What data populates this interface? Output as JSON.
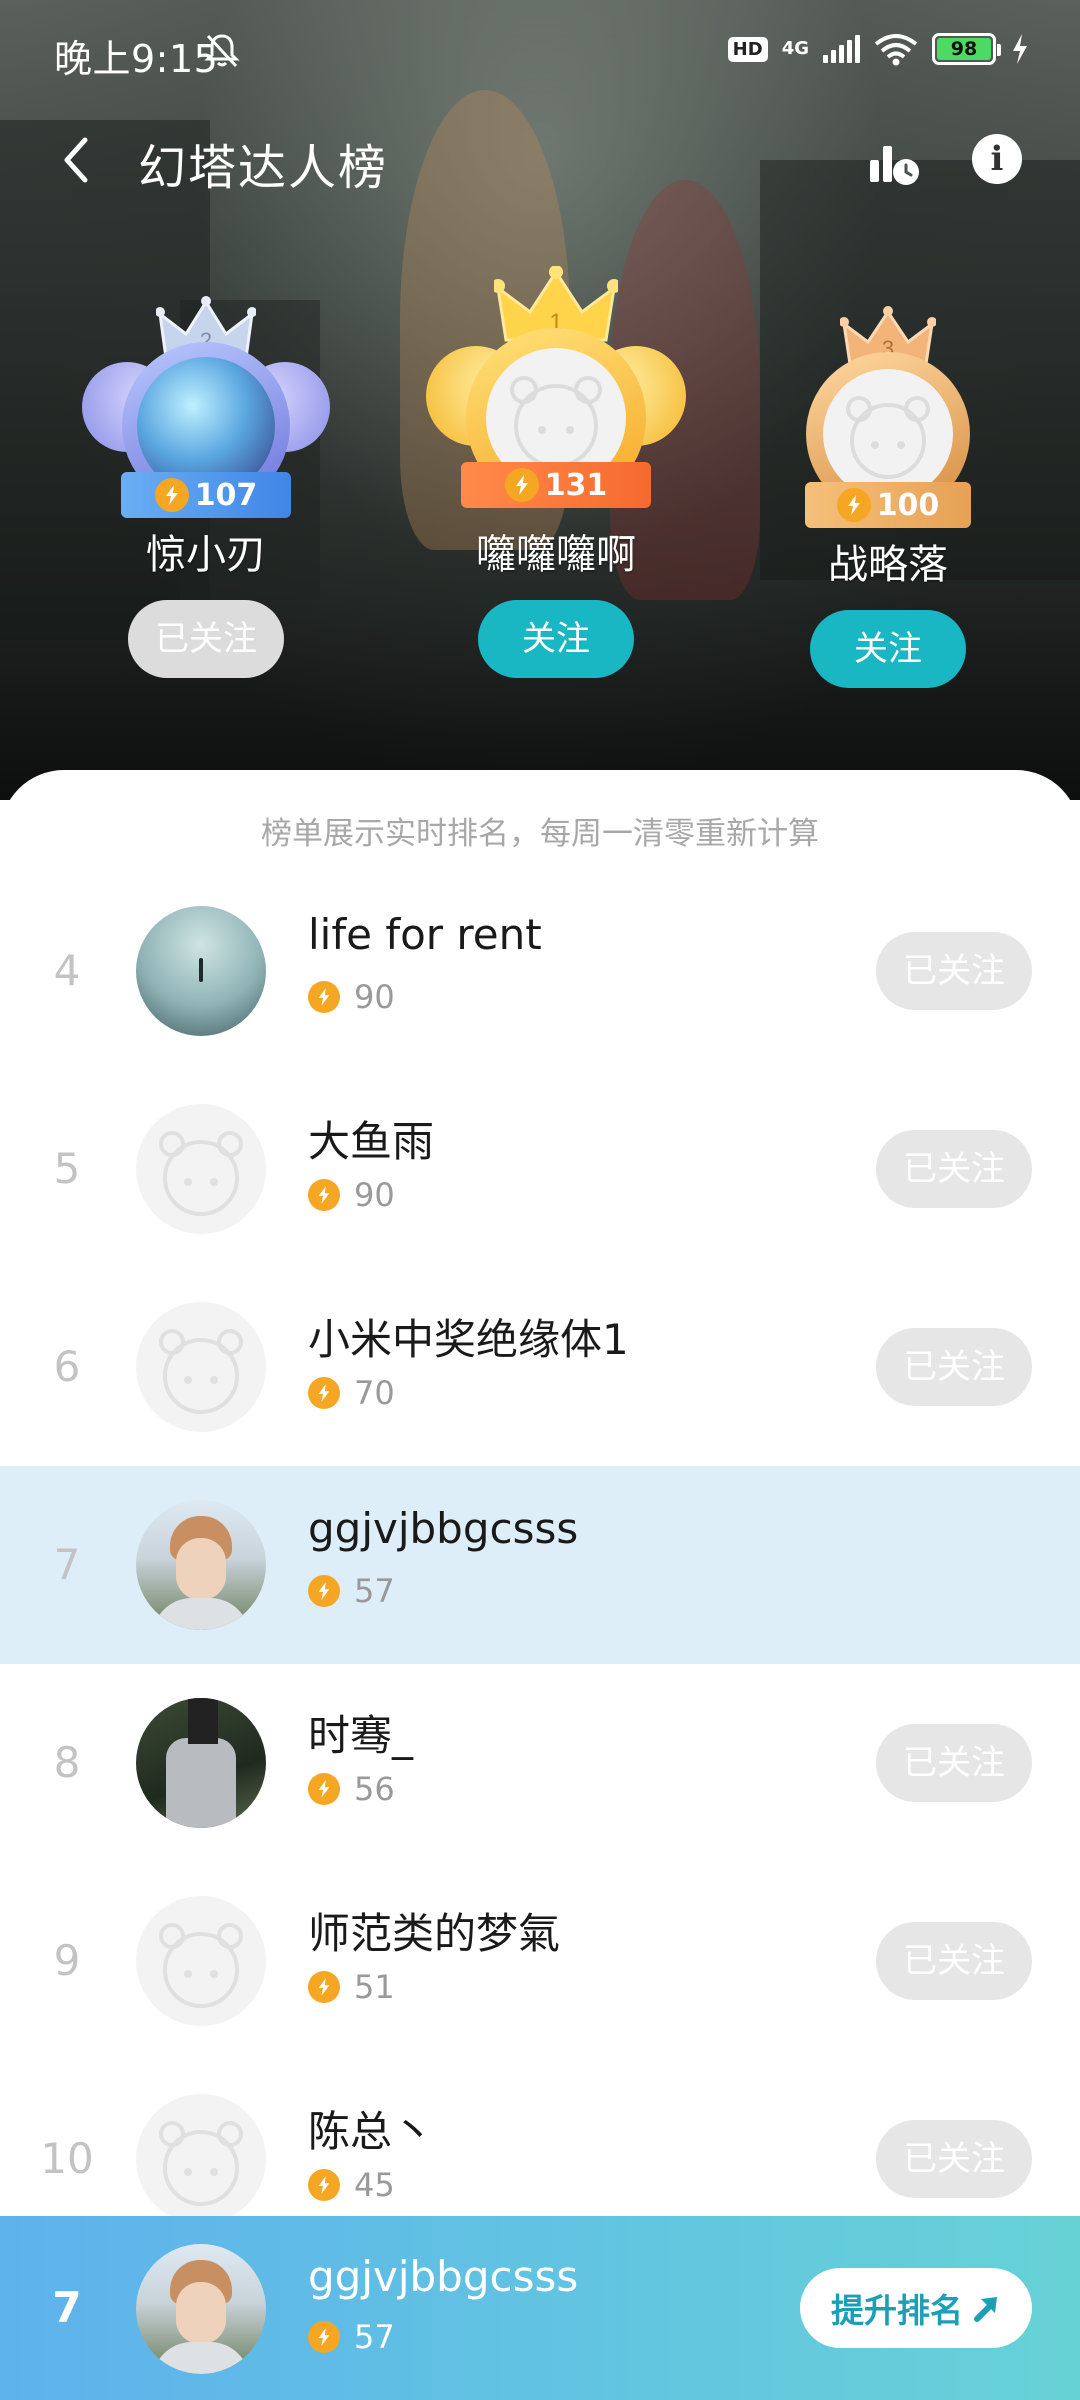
{
  "status_bar": {
    "time": "晚上9:15",
    "hd": "HD",
    "network": "4G",
    "battery": "98"
  },
  "header": {
    "title": "幻塔达人榜"
  },
  "podium": [
    {
      "rank": "2",
      "name": "惊小刃",
      "score": "107",
      "follow_label": "已关注",
      "followed": true
    },
    {
      "rank": "1",
      "name": "囖囖囖啊",
      "score": "131",
      "follow_label": "关注",
      "followed": false
    },
    {
      "rank": "3",
      "name": "战略落",
      "score": "100",
      "follow_label": "关注",
      "followed": false
    }
  ],
  "notice": "榜单展示实时排名，每周一清零重新计算",
  "list": [
    {
      "rank": "4",
      "name": "life for rent",
      "score": "90",
      "follow_label": "已关注"
    },
    {
      "rank": "5",
      "name": "大鱼雨",
      "score": "90",
      "follow_label": "已关注"
    },
    {
      "rank": "6",
      "name": "小米中奖绝缘体1",
      "score": "70",
      "follow_label": "已关注"
    },
    {
      "rank": "7",
      "name": "ggjvjbbgcsss",
      "score": "57",
      "follow_label": ""
    },
    {
      "rank": "8",
      "name": "时骞_",
      "score": "56",
      "follow_label": "已关注"
    },
    {
      "rank": "9",
      "name": "师范类的梦氣",
      "score": "51",
      "follow_label": "已关注"
    },
    {
      "rank": "10",
      "name": "陈总丶",
      "score": "45",
      "follow_label": "已关注"
    }
  ],
  "me": {
    "rank": "7",
    "name": "ggjvjbbgcsss",
    "score": "57",
    "boost_label": "提升排名"
  },
  "colors": {
    "follow_active": "#19b7c4",
    "followed": "#dcdcdc",
    "lightning": "#f5a623",
    "highlight_row": "#ddeef9",
    "bottom_bar_start": "#5eb2ec",
    "bottom_bar_end": "#67d2d6"
  }
}
